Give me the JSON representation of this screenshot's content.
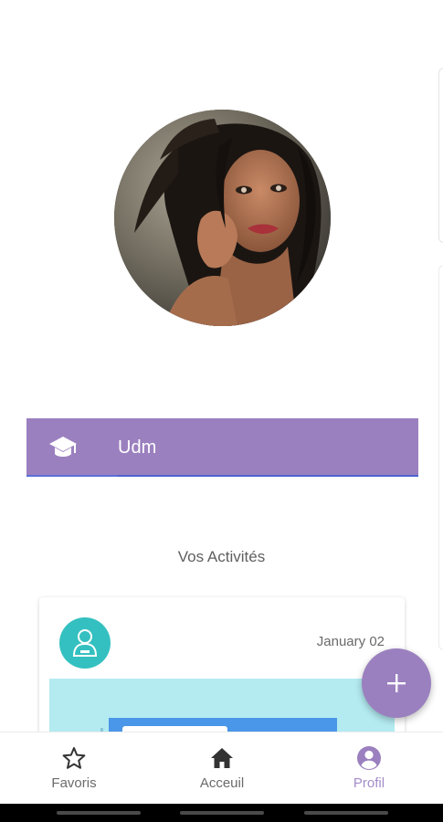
{
  "profile": {
    "avatar_alt": "profile photo",
    "school": {
      "icon": "graduation-cap-icon",
      "value": "Udm"
    }
  },
  "activities": {
    "section_title": "Vos Activités",
    "items": [
      {
        "avatar_icon": "person-icon",
        "date": "January 02"
      }
    ]
  },
  "fab": {
    "icon": "plus-icon"
  },
  "bottom_nav": {
    "items": [
      {
        "label": "Favoris",
        "icon": "star-icon",
        "active": false
      },
      {
        "label": "Acceuil",
        "icon": "home-icon",
        "active": false
      },
      {
        "label": "Profil",
        "icon": "account-circle-icon",
        "active": true
      }
    ]
  },
  "colors": {
    "accent": "#9b80bf",
    "activity_avatar": "#34c0c0",
    "preview_bg": "#b3ebf1",
    "preview_inner": "#4a96e8",
    "nav_active": "#a38cc9",
    "nav_inactive": "#6b6b6b"
  }
}
